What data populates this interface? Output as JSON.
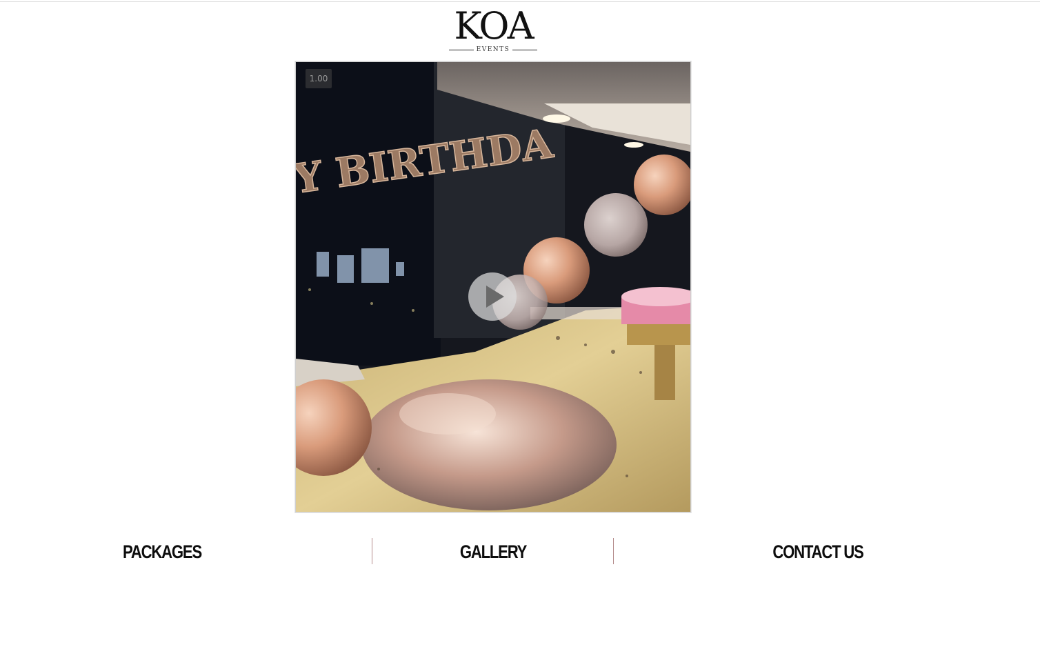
{
  "brand": {
    "logo_word": "KOA",
    "logo_sub": "EVENTS"
  },
  "video": {
    "speed_label": "1.00",
    "banner_text": "Y BIRTHDA",
    "play_icon": "play-icon"
  },
  "nav": {
    "items": [
      {
        "label": "PACKAGES"
      },
      {
        "label": "GALLERY"
      },
      {
        "label": "CONTACT US"
      }
    ]
  },
  "colors": {
    "background": "#ffffff",
    "nav_text": "#0d0d0d",
    "divider": "#b38a8a",
    "rose_gold": "#d9a083"
  }
}
